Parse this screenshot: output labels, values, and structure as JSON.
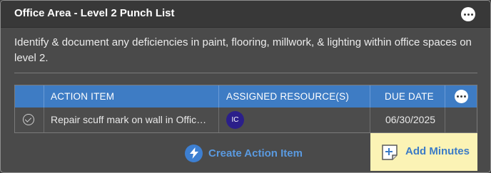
{
  "card": {
    "title": "Office Area - Level 2 Punch List",
    "more_icon": "more-horizontal-icon",
    "description": "Identify & document any deficiencies in paint, flooring, millwork, & lighting within office spaces on level 2."
  },
  "table": {
    "headers": {
      "action_item": "ACTION ITEM",
      "assigned_resources": "ASSIGNED RESOURCE(S)",
      "due_date": "DUE DATE"
    },
    "rows": [
      {
        "status_icon": "check-circle-icon",
        "action_item": "Repair scuff mark on wall in Offic…",
        "assignee_initials": "IC",
        "due_date": "06/30/2025"
      }
    ]
  },
  "actions": {
    "create_label": "Create Action Item",
    "add_minutes_label": "Add Minutes"
  },
  "colors": {
    "header_blue": "#3e7cc4",
    "link_blue": "#5a9ae0",
    "avatar_purple": "#2b1f8a",
    "highlight_yellow": "#fbf3b5"
  }
}
